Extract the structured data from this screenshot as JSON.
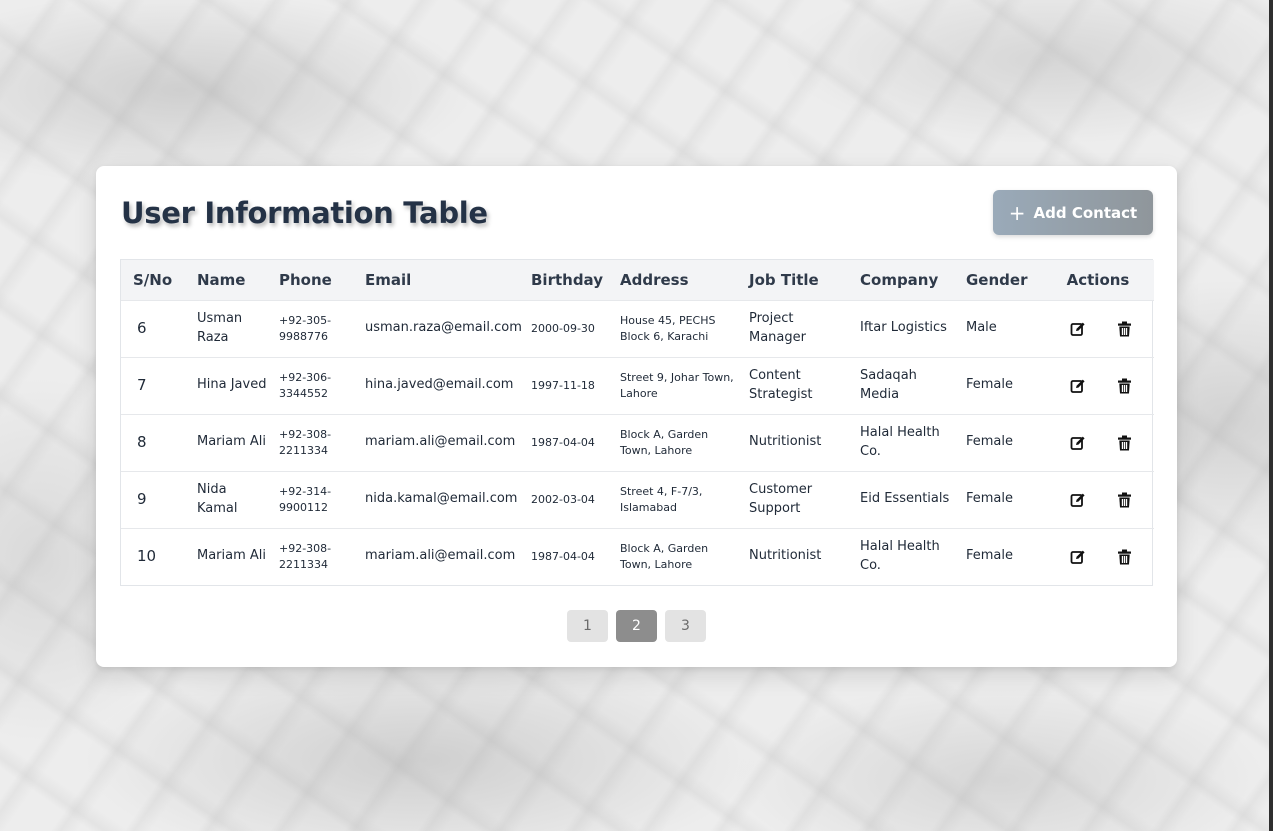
{
  "page": {
    "title": "User Information Table",
    "add_button_label": "Add Contact"
  },
  "table": {
    "columns": [
      "S/No",
      "Name",
      "Phone",
      "Email",
      "Birthday",
      "Address",
      "Job Title",
      "Company",
      "Gender",
      "Actions"
    ],
    "rows": [
      {
        "sno": "6",
        "name": "Usman Raza",
        "phone": "+92-305-9988776",
        "email": "usman.raza@email.com",
        "birthday": "2000-09-30",
        "address": "House 45, PECHS Block 6, Karachi",
        "job_title": "Project Manager",
        "company": "Iftar Logistics",
        "gender": "Male"
      },
      {
        "sno": "7",
        "name": "Hina Javed",
        "phone": "+92-306-3344552",
        "email": "hina.javed@email.com",
        "birthday": "1997-11-18",
        "address": "Street 9, Johar Town, Lahore",
        "job_title": "Content Strategist",
        "company": "Sadaqah Media",
        "gender": "Female"
      },
      {
        "sno": "8",
        "name": "Mariam Ali",
        "phone": "+92-308-2211334",
        "email": "mariam.ali@email.com",
        "birthday": "1987-04-04",
        "address": "Block A, Garden Town, Lahore",
        "job_title": "Nutritionist",
        "company": "Halal Health Co.",
        "gender": "Female"
      },
      {
        "sno": "9",
        "name": "Nida Kamal",
        "phone": "+92-314-9900112",
        "email": "nida.kamal@email.com",
        "birthday": "2002-03-04",
        "address": "Street 4, F-7/3, Islamabad",
        "job_title": "Customer Support",
        "company": "Eid Essentials",
        "gender": "Female"
      },
      {
        "sno": "10",
        "name": "Mariam Ali",
        "phone": "+92-308-2211334",
        "email": "mariam.ali@email.com",
        "birthday": "1987-04-04",
        "address": "Block A, Garden Town, Lahore",
        "job_title": "Nutritionist",
        "company": "Halal Health Co.",
        "gender": "Female"
      }
    ],
    "row_action_icons": [
      "edit-icon",
      "trash-icon"
    ]
  },
  "pagination": {
    "pages": [
      "1",
      "2",
      "3"
    ],
    "current": "2"
  },
  "colors": {
    "title": "#243246",
    "button_gradient_start": "#9aaab9",
    "button_gradient_end": "#8f969b",
    "active_page": "#8d8d8d"
  }
}
